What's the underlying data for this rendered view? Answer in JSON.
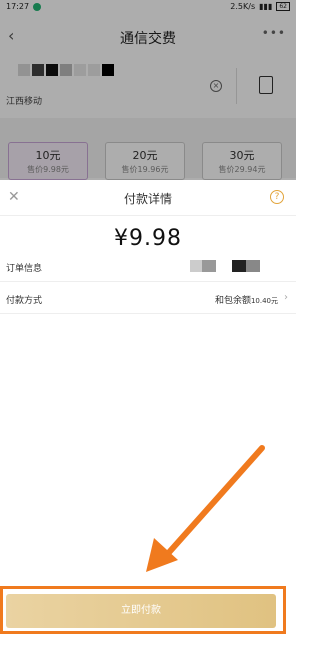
{
  "status": {
    "time": "17:27",
    "speed": "2.5K/s",
    "battery": "62"
  },
  "navbar": {
    "title": "通信交费"
  },
  "phone": {
    "carrier": "江西移动"
  },
  "cards": [
    {
      "amount": "10元",
      "price": "售价9.98元"
    },
    {
      "amount": "20元",
      "price": "售价19.96元"
    },
    {
      "amount": "30元",
      "price": "售价29.94元"
    }
  ],
  "sheet": {
    "title": "付款详情",
    "amount": "¥9.98",
    "order_label": "订单信息",
    "payment_label": "付款方式",
    "payment_value": "和包余额",
    "payment_balance": "10.40元",
    "pay_button": "立即付款"
  },
  "colors": {
    "accent": "#e0c281",
    "highlight": "#f07a1e"
  }
}
